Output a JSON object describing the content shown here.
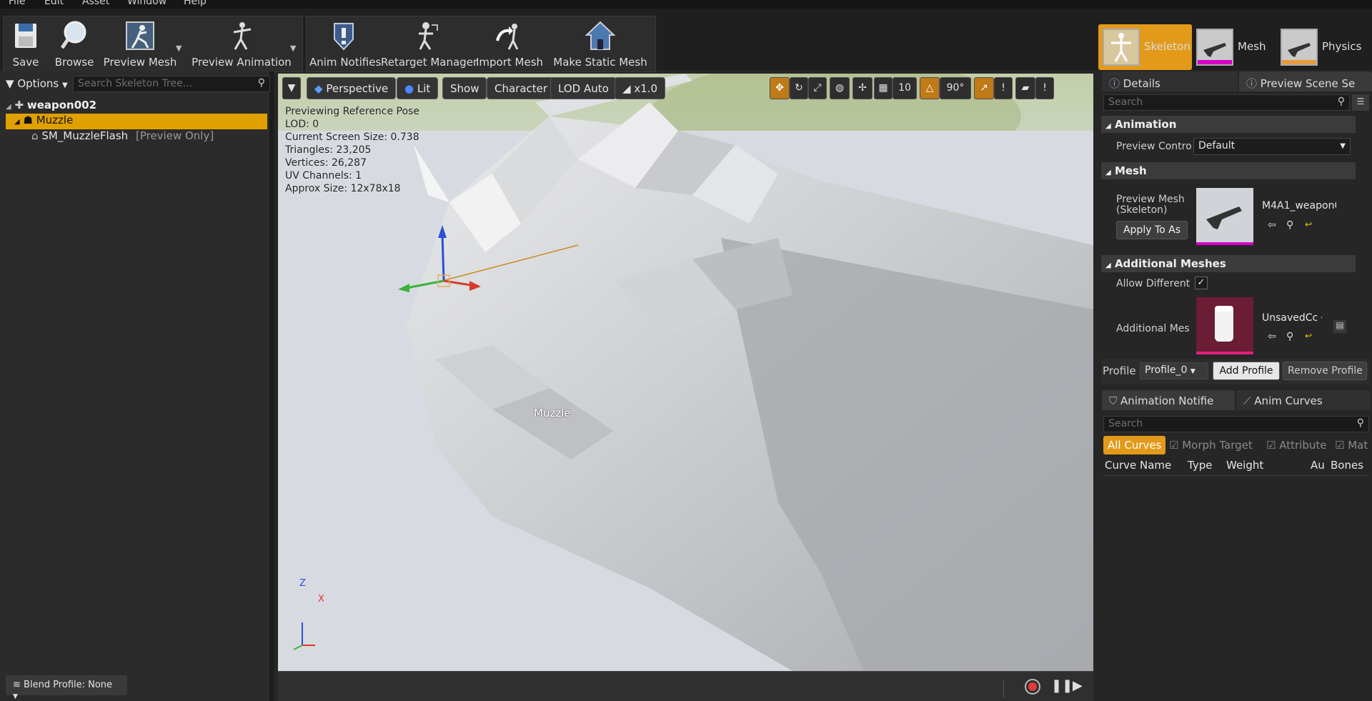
{
  "menu": [
    "File",
    "Edit",
    "Asset",
    "Window",
    "Help"
  ],
  "toolbar": {
    "save": "Save",
    "browse": "Browse",
    "preview_mesh": "Preview Mesh",
    "preview_animation": "Preview Animation",
    "anim_notifies": "Anim Notifies",
    "retarget_manager": "Retarget Manager",
    "import_mesh": "Import Mesh",
    "make_static_mesh": "Make Static Mesh"
  },
  "modes": {
    "skeleton": "Skeleton",
    "mesh": "Mesh",
    "physics": "Physics"
  },
  "skeleton_tree": {
    "options": "Options",
    "search_placeholder": "Search Skeleton Tree...",
    "root": "weapon002",
    "bone": "Muzzle",
    "child": "SM_MuzzleFlash",
    "child_tag": "[Preview Only]",
    "blend_profile": "Blend Profile: None"
  },
  "viewport": {
    "perspective": "Perspective",
    "lit": "Lit",
    "show": "Show",
    "character": "Character",
    "lod": "LOD Auto",
    "speed": "x1.0",
    "grid_size": "10",
    "angle": "90°",
    "stats": [
      "Previewing Reference Pose",
      "LOD: 0",
      "Current Screen Size: 0.738",
      "Triangles: 23,205",
      "Vertices: 26,287",
      "UV Channels: 1",
      "Approx Size: 12x78x18"
    ],
    "bone_label": "Muzzle",
    "axis_z": "Z",
    "axis_x": "X"
  },
  "details": {
    "tab_details": "Details",
    "tab_preview": "Preview Scene Se",
    "search_placeholder": "Search",
    "section_animation": "Animation",
    "preview_controller_label": "Preview Contro",
    "preview_controller_value": "Default",
    "section_mesh": "Mesh",
    "preview_mesh_label": "Preview Mesh (Skeleton)",
    "preview_mesh_value": "M4A1_weapon0(",
    "apply_to_asset": "Apply To As",
    "section_additional": "Additional Meshes",
    "allow_different_label": "Allow Different",
    "additional_mesh_label": "Additional Mes",
    "additional_mesh_value": "UnsavedCc",
    "profile_label": "Profile",
    "profile_value": "Profile_0",
    "add_profile": "Add Profile",
    "remove_profile": "Remove Profile"
  },
  "curves": {
    "tab_notifies": "Animation Notifie",
    "tab_curves": "Anim Curves",
    "search_placeholder": "Search",
    "filter_all": "All Curves",
    "filter_morph": "Morph Target",
    "filter_attribute": "Attribute",
    "filter_mat": "Mat",
    "col_name": "Curve Name",
    "col_type": "Type",
    "col_weight": "Weight",
    "col_au": "Au",
    "col_bones": "Bones"
  },
  "colors": {
    "accent": "#e8a000",
    "background": "#262626",
    "selection": "#e0a000"
  }
}
